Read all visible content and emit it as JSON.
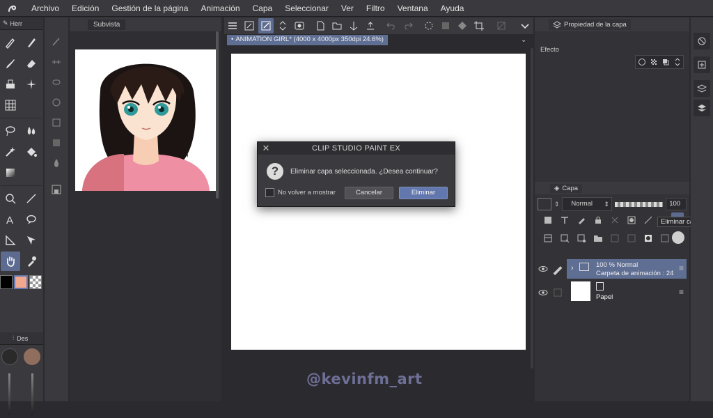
{
  "menu": [
    "Archivo",
    "Edición",
    "Gestión de la página",
    "Animación",
    "Capa",
    "Seleccionar",
    "Ver",
    "Filtro",
    "Ventana",
    "Ayuda"
  ],
  "tool_panel": {
    "tab_label": "Herr",
    "sub_tab_label": "Des"
  },
  "colors": {
    "main": "#000000",
    "sub": "#f0a88e",
    "accent": "#6277ad",
    "active_tool": "#5c6b8f"
  },
  "subview": {
    "title": "Subvista"
  },
  "document_tab": {
    "label": "ANIMATION GIRL* (4000 x 4000px 350dpi 24.6%)"
  },
  "watermark": "@kevinfm_art",
  "dialog": {
    "title": "CLIP STUDIO PAINT EX",
    "message": "Eliminar capa seleccionada. ¿Desea continuar?",
    "checkbox_label": "No volver a mostrar",
    "cancel_label": "Cancelar",
    "delete_label": "Eliminar"
  },
  "layer_property": {
    "tab_label": "Propiedad de la capa",
    "effect_label": "Efecto"
  },
  "layer_panel": {
    "tab_label": "Capa",
    "blend_mode": "Normal",
    "opacity": "100",
    "tooltip": "Eliminar capa",
    "layers": [
      {
        "line1": "100 %  Normal",
        "line2": "Carpeta de animación : 24"
      },
      {
        "line1": "Papel",
        "line2": ""
      }
    ]
  }
}
